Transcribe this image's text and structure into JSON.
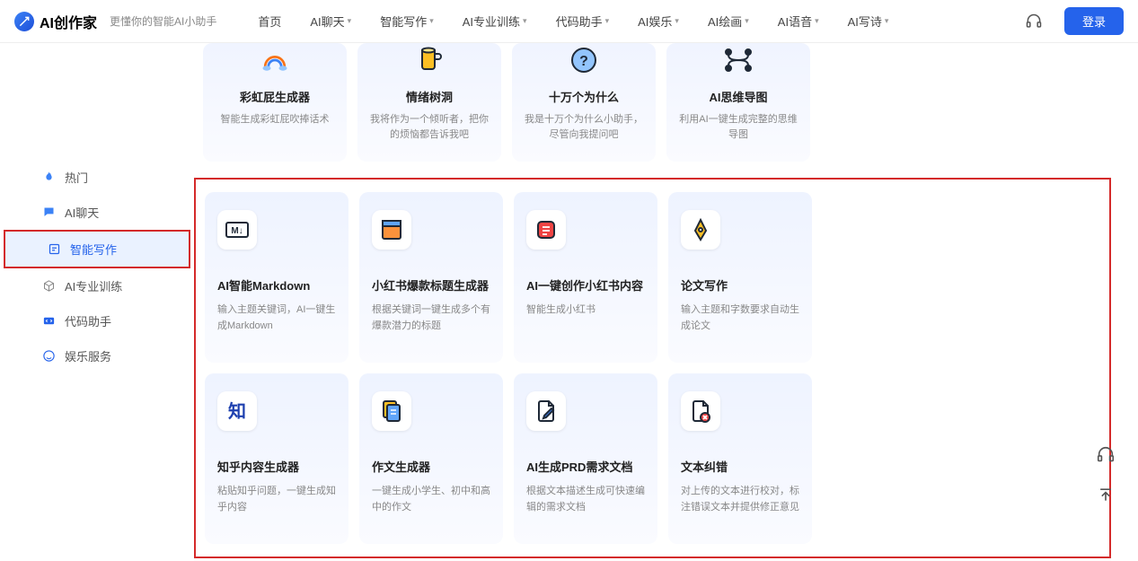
{
  "header": {
    "logo_text": "AI创作家",
    "tagline": "更懂你的智能AI小助手",
    "nav": [
      "首页",
      "AI聊天",
      "智能写作",
      "AI专业训练",
      "代码助手",
      "AI娱乐",
      "AI绘画",
      "AI语音",
      "AI写诗"
    ],
    "login": "登录"
  },
  "sidebar": {
    "items": [
      {
        "label": "热门",
        "icon": "fire"
      },
      {
        "label": "AI聊天",
        "icon": "chat"
      },
      {
        "label": "智能写作",
        "icon": "edit",
        "active": true
      },
      {
        "label": "AI专业训练",
        "icon": "cube"
      },
      {
        "label": "代码助手",
        "icon": "code"
      },
      {
        "label": "娱乐服务",
        "icon": "smile"
      }
    ]
  },
  "top_cards": [
    {
      "title": "彩虹屁生成器",
      "desc": "智能生成彩虹屁吹捧话术"
    },
    {
      "title": "情绪树洞",
      "desc": "我将作为一个倾听者，把你的烦恼都告诉我吧"
    },
    {
      "title": "十万个为什么",
      "desc": "我是十万个为什么小助手，尽管向我提问吧"
    },
    {
      "title": "AI思维导图",
      "desc": "利用AI一键生成完整的思维导图"
    }
  ],
  "main_cards": [
    {
      "title": "AI智能Markdown",
      "desc": "输入主题关键词，AI一键生成Markdown"
    },
    {
      "title": "小红书爆款标题生成器",
      "desc": "根据关键词一键生成多个有爆款潜力的标题"
    },
    {
      "title": "AI一键创作小红书内容",
      "desc": "智能生成小红书"
    },
    {
      "title": "论文写作",
      "desc": "输入主题和字数要求自动生成论文"
    },
    {
      "title": "知乎内容生成器",
      "desc": "粘贴知乎问题，一键生成知乎内容"
    },
    {
      "title": "作文生成器",
      "desc": "一键生成小学生、初中和高中的作文"
    },
    {
      "title": "AI生成PRD需求文档",
      "desc": "根据文本描述生成可快速编辑的需求文档"
    },
    {
      "title": "文本纠错",
      "desc": "对上传的文本进行校对，标注错误文本并提供修正意见"
    }
  ]
}
